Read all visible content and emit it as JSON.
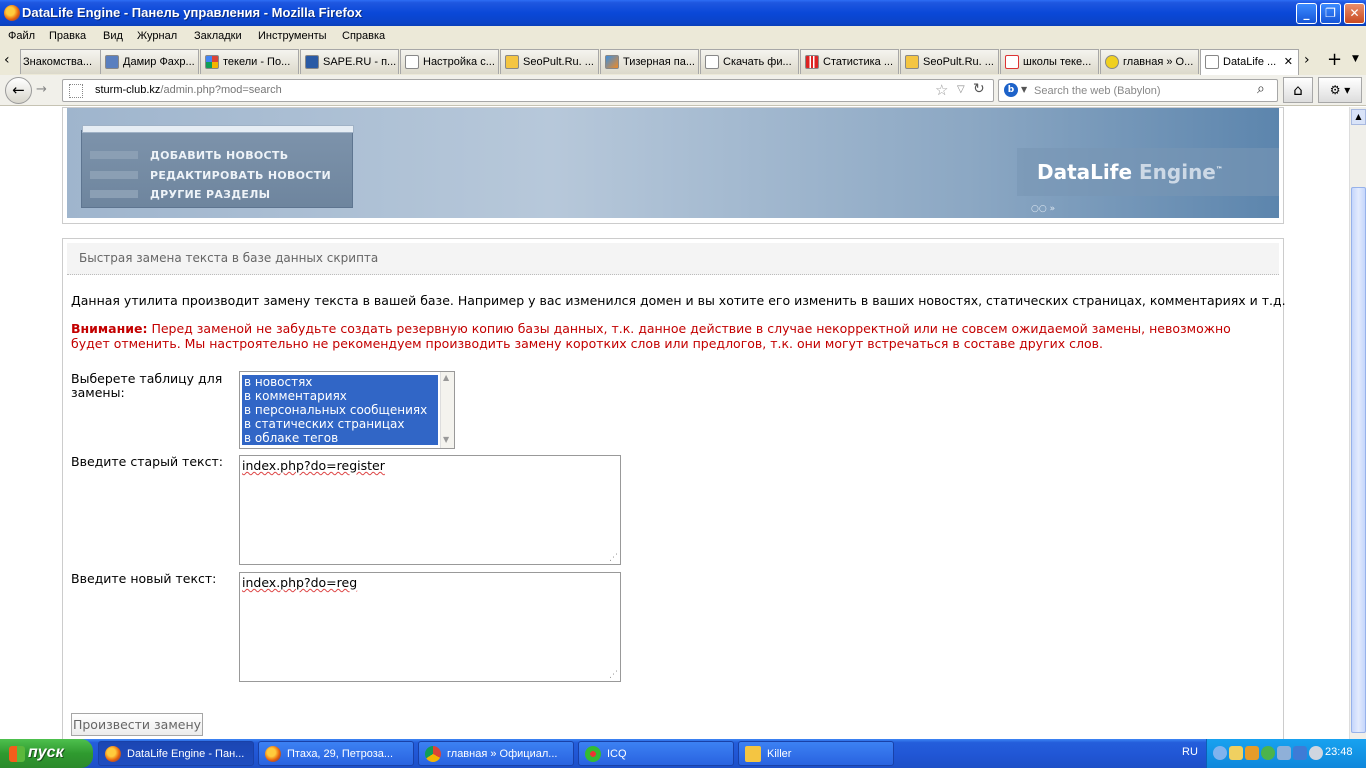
{
  "window": {
    "title": "DataLife Engine - Панель управления - Mozilla Firefox",
    "minimize": "_",
    "maximize": "❐",
    "close": "✕"
  },
  "menu": [
    "Файл",
    "Правка",
    "Вид",
    "Журнал",
    "Закладки",
    "Инструменты",
    "Справка"
  ],
  "tabs": [
    {
      "label": "Знакомства..."
    },
    {
      "label": "Дамир Фахр..."
    },
    {
      "label": "текели - По..."
    },
    {
      "label": "SAPE.RU - п..."
    },
    {
      "label": "Настройка с..."
    },
    {
      "label": "SeoPult.Ru. ..."
    },
    {
      "label": "Тизерная па..."
    },
    {
      "label": "Скачать фи..."
    },
    {
      "label": "Статистика ..."
    },
    {
      "label": "SeoPult.Ru. ..."
    },
    {
      "label": "школы теке..."
    },
    {
      "label": "главная » О..."
    },
    {
      "label": "DataLife ..."
    }
  ],
  "nav": {
    "url_host": "sturm-club.kz",
    "url_path": "/admin.php?mod=search",
    "search_placeholder": "Search the web (Babylon)"
  },
  "header": {
    "menu_items": [
      "ДОБАВИТЬ НОВОСТЬ",
      "РЕДАКТИРОВАТЬ НОВОСТИ",
      "ДРУГИЕ РАЗДЕЛЫ"
    ],
    "logo_main": "DataLife",
    "logo_engine": "Engine",
    "logo_tm": "™"
  },
  "main": {
    "section_title": "Быстрая замена текста в базе данных скрипта",
    "description": "Данная утилита производит замену текста в вашей базе. Например у вас изменился домен и вы хотите его изменить в ваших новостях, статических страницах, комментариях и т.д.",
    "warning_label": "Внимание:",
    "warning_text": "Перед заменой не забудьте создать резервную копию базы данных, т.к. данное действие в случае некорректной или не совсем ожидаемой замены, невозможно будет отменить. Мы настроятельно не рекомендуем производить замену коротких слов или предлогов, т.к. они могут встречаться в составе других слов.",
    "table_label": "Выберете таблицу для замены:",
    "table_options": [
      "в новостях",
      "в комментариях",
      "в персональных сообщениях",
      "в статических страницах",
      "в облаке тегов"
    ],
    "old_text_label": "Введите старый текст:",
    "old_text_value": "index.php?do=register",
    "new_text_label": "Введите новый текст:",
    "new_text_value": "index.php?do=reg",
    "submit_label": "Произвести замену"
  },
  "taskbar": {
    "start_label": "пуск",
    "tasks": [
      {
        "label": "DataLife Engine - Пан..."
      },
      {
        "label": "Птаха, 29, Петроза..."
      },
      {
        "label": "главная » Официал..."
      },
      {
        "label": "ICQ"
      },
      {
        "label": "Killer"
      }
    ],
    "lang": "RU",
    "clock": "23:48"
  }
}
